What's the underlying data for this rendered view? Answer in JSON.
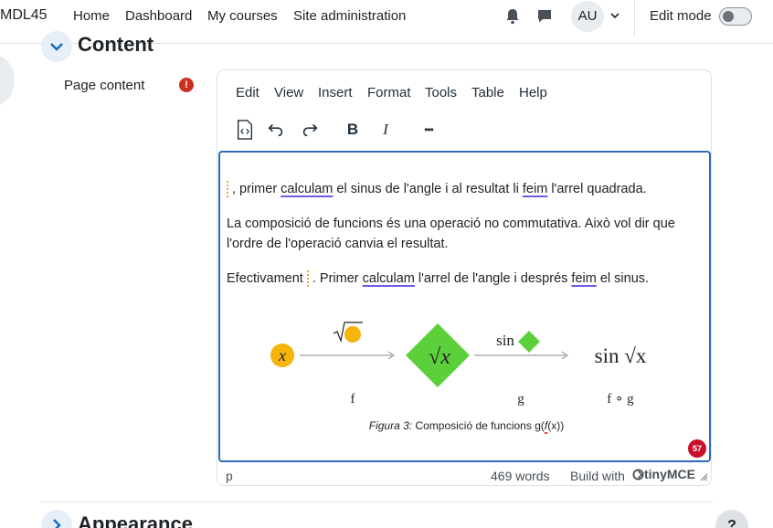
{
  "nav": {
    "brand": "MDL45",
    "links": [
      "Home",
      "Dashboard",
      "My courses",
      "Site administration"
    ],
    "avatar_initials": "AU",
    "edit_mode_label": "Edit mode",
    "edit_mode_on": false
  },
  "sections": {
    "content_title": "Content",
    "appearance_title": "Appearance",
    "help_glyph": "?"
  },
  "form": {
    "page_content_label": "Page content",
    "required_glyph": "!"
  },
  "editor": {
    "menu": [
      "Edit",
      "View",
      "Insert",
      "Format",
      "Tools",
      "Table",
      "Help"
    ],
    "toolbar_icons": [
      "source-code-icon",
      "undo-icon",
      "redo-icon",
      "bold-icon",
      "italic-icon",
      "more-icon"
    ],
    "bold_glyph": "B",
    "italic_glyph": "I",
    "more_glyph": "•••",
    "paragraphs": {
      "p1": [
        ", primer ",
        "calculam",
        " el sinus de l'angle i al resultat li ",
        "feim",
        " l'arrel quadrada."
      ],
      "p2": "La composició de funcions és una operació no commutativa. Això vol dir que l'ordre de l'operació canvia el resultat.",
      "p3": [
        "Efectivament ",
        ". Primer ",
        "calculam",
        " l'arrel de l'angle i després ",
        "feim",
        " el sinus."
      ]
    },
    "figure": {
      "x_symbol": "x",
      "sqrt_x": "√x",
      "sin_label": "sin",
      "sin_sqrt_label": "sin √x",
      "f_label": "f",
      "g_label": "g",
      "fog_label": "f ∘ g",
      "caption_prefix": "Figura 3:",
      "caption_text": " Composició de funcions g(",
      "caption_f": "f",
      "caption_end": "(x))",
      "colors": {
        "circle": "#f5b50b",
        "diamond": "#5cd03a"
      }
    },
    "notification_count": "57",
    "status_path": "p",
    "word_count": "469 words",
    "build_with": "Build with",
    "brand": "tinyMCE"
  }
}
